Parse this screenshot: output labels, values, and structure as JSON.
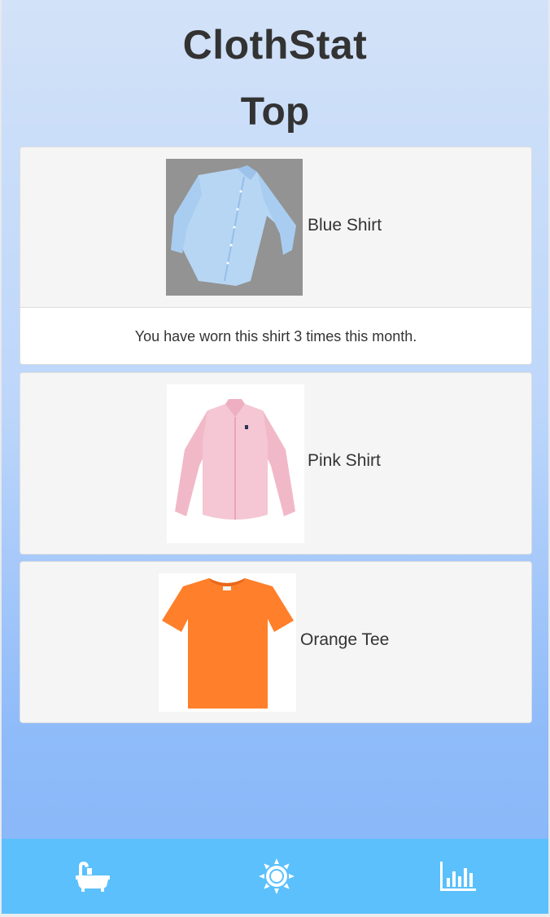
{
  "app": {
    "title": "ClothStat",
    "section_title": "Top"
  },
  "items": [
    {
      "name": "Blue Shirt",
      "image": "blue-shirt-image",
      "detail": "You have worn this shirt 3 times this month."
    },
    {
      "name": "Pink Shirt",
      "image": "pink-shirt-image"
    },
    {
      "name": "Orange Tee",
      "image": "orange-tee-image"
    }
  ],
  "nav": {
    "background": "#5bc0fc",
    "buttons": [
      {
        "icon": "bathtub-icon"
      },
      {
        "icon": "sun-icon"
      },
      {
        "icon": "bar-chart-icon"
      }
    ]
  }
}
